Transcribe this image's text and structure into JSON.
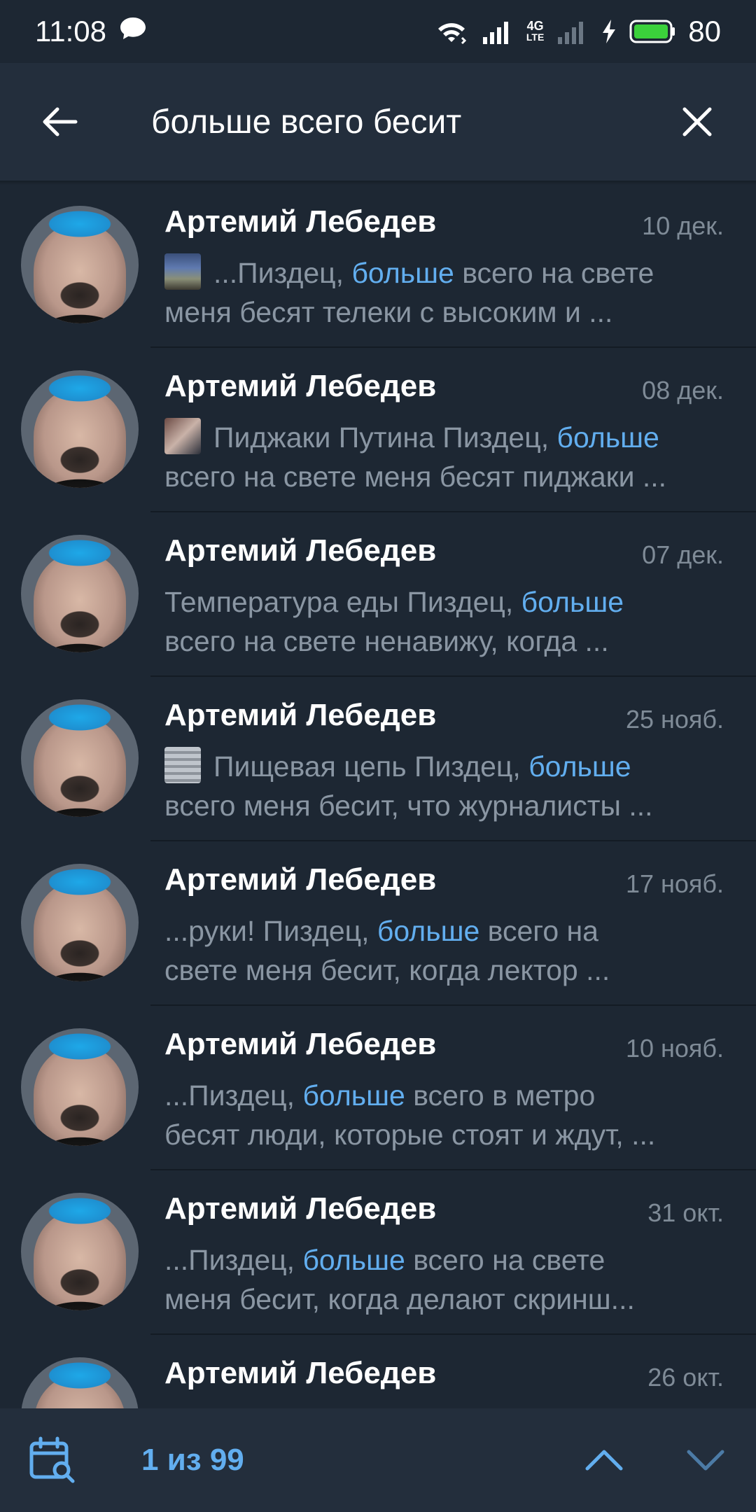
{
  "status_bar": {
    "time": "11:08",
    "network": "4G",
    "network_sub": "LTE",
    "battery": "80",
    "icons": [
      "chat-bubble-icon",
      "wifi-icon",
      "signal-icon",
      "charging-icon",
      "battery-icon"
    ]
  },
  "search": {
    "query": "больше всего бесит"
  },
  "results": [
    {
      "name": "Артемий Лебедев",
      "date": "10 дек.",
      "thumb": "photo",
      "pre": "...Пиздец, ",
      "hl": "больше",
      "post": " всего на свете",
      "line2": "меня бесят телеки с высоким и ..."
    },
    {
      "name": "Артемий Лебедев",
      "date": "08 дек.",
      "thumb": "photo",
      "pre": "Пиджаки Путина Пиздец, ",
      "hl": "больше",
      "post": "",
      "line2": "всего на свете меня бесят пиджаки ..."
    },
    {
      "name": "Артемий Лебедев",
      "date": "07 дек.",
      "thumb": "",
      "pre": "Температура еды Пиздец, ",
      "hl": "больше",
      "post": "",
      "line2": "всего на свете ненавижу, когда ..."
    },
    {
      "name": "Артемий Лебедев",
      "date": "25 нояб.",
      "thumb": "photo",
      "pre": "Пищевая цепь Пиздец, ",
      "hl": "больше",
      "post": "",
      "line2": "всего меня бесит, что журналисты ..."
    },
    {
      "name": "Артемий Лебедев",
      "date": "17 нояб.",
      "thumb": "",
      "pre": "...руки! Пиздец, ",
      "hl": "больше",
      "post": " всего на",
      "line2": "свете меня бесит, когда лектор ..."
    },
    {
      "name": "Артемий Лебедев",
      "date": "10 нояб.",
      "thumb": "",
      "pre": "...Пиздец, ",
      "hl": "больше",
      "post": " всего в метро",
      "line2": "бесят люди, которые стоят и ждут, ..."
    },
    {
      "name": "Артемий Лебедев",
      "date": "31 окт.",
      "thumb": "",
      "pre": "...Пиздец, ",
      "hl": "больше",
      "post": " всего на свете",
      "line2": "меня бесит, когда делают скринш..."
    },
    {
      "name": "Артемий Лебедев",
      "date": "26 окт.",
      "thumb": "",
      "pre": "",
      "hl": "",
      "post": "",
      "line2": ""
    }
  ],
  "bottom_bar": {
    "counter": "1 из 99"
  },
  "colors": {
    "background": "#1d2733",
    "header": "#232e3c",
    "accent": "#62aeef",
    "secondary_text": "#8a96a3",
    "battery": "#3bd13b"
  }
}
